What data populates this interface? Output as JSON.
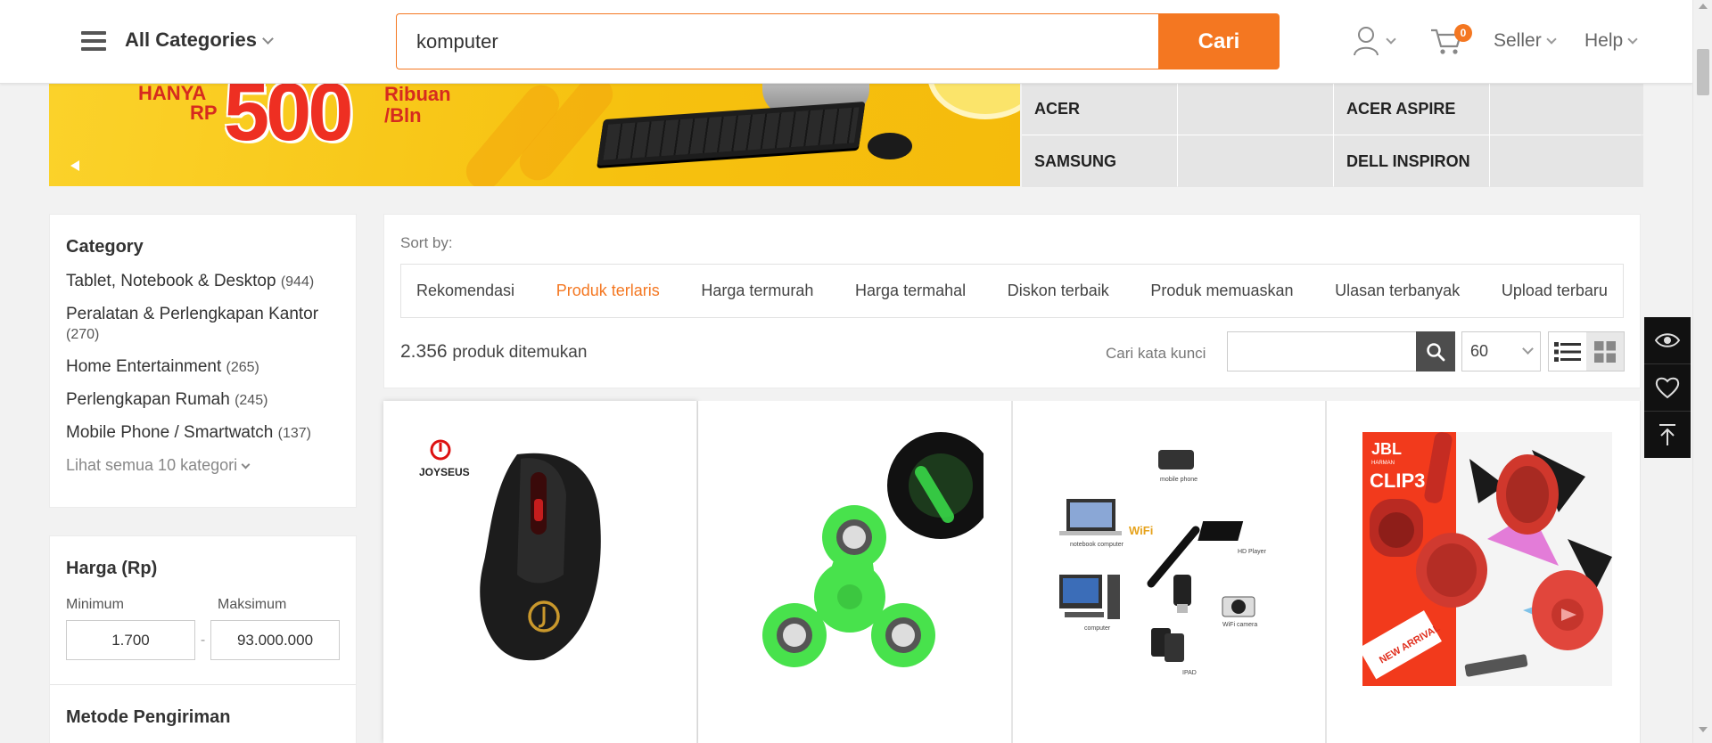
{
  "header": {
    "categories_label": "All Categories",
    "search_value": "komputer",
    "search_button": "Cari",
    "cart_count": "0",
    "seller_label": "Seller",
    "help_label": "Help",
    "accent_color": "#f47721"
  },
  "banner": {
    "text_hanya": "HANYA",
    "text_rp": "RP",
    "text_amount": "500",
    "text_ribuan": "Ribuan",
    "text_bln": "/Bln"
  },
  "brands": [
    "ACER",
    "",
    "ACER ASPIRE",
    "",
    "SAMSUNG",
    "",
    "DELL INSPIRON",
    ""
  ],
  "sidebar": {
    "category_title": "Category",
    "categories": [
      {
        "name": "Tablet, Notebook & Desktop",
        "count": "(944)"
      },
      {
        "name": "Peralatan & Perlengkapan Kantor",
        "count": "(270)"
      },
      {
        "name": "Home Entertainment",
        "count": "(265)"
      },
      {
        "name": "Perlengkapan Rumah",
        "count": "(245)"
      },
      {
        "name": "Mobile Phone / Smartwatch",
        "count": "(137)"
      }
    ],
    "see_all": "Lihat semua 10 kategori",
    "price_title": "Harga (Rp)",
    "min_label": "Minimum",
    "max_label": "Maksimum",
    "min_value": "1.700",
    "max_value": "93.000.000",
    "price_dash": "-",
    "shipping_title": "Metode Pengiriman"
  },
  "sort": {
    "label": "Sort by:",
    "tabs": [
      "Rekomendasi",
      "Produk terlaris",
      "Harga termurah",
      "Harga termahal",
      "Diskon terbaik",
      "Produk memuaskan",
      "Ulasan terbanyak",
      "Upload terbaru"
    ],
    "active_tab": "Produk terlaris",
    "result_number": "2.356",
    "result_label": "produk ditemukan",
    "keyword_label": "Cari kata kunci",
    "keyword_value": "",
    "per_page": "60"
  },
  "products": [
    {
      "image": "joyseus-wireless-mouse",
      "brand_text": "JOYSEUS"
    },
    {
      "image": "green-fidget-spinner"
    },
    {
      "image": "usb-wifi-adapter-devices",
      "labels": [
        "mobile phone",
        "notebook computer",
        "HD Player",
        "computer",
        "WiFi camera",
        "IPAD"
      ],
      "wifi_text": "WiFi"
    },
    {
      "image": "jbl-clip3-speaker",
      "brand": "JBL",
      "brand_sub": "HARMAN",
      "model": "CLIP3",
      "ribbon": "NEW ARRIVAL"
    }
  ],
  "icons": {
    "menu": "hamburger-icon",
    "user": "user-icon",
    "cart": "cart-icon",
    "search": "search-icon",
    "list_view": "list-view-icon",
    "grid_view": "grid-view-icon",
    "eye": "eye-icon",
    "heart": "heart-icon",
    "to_top": "back-to-top-icon"
  }
}
